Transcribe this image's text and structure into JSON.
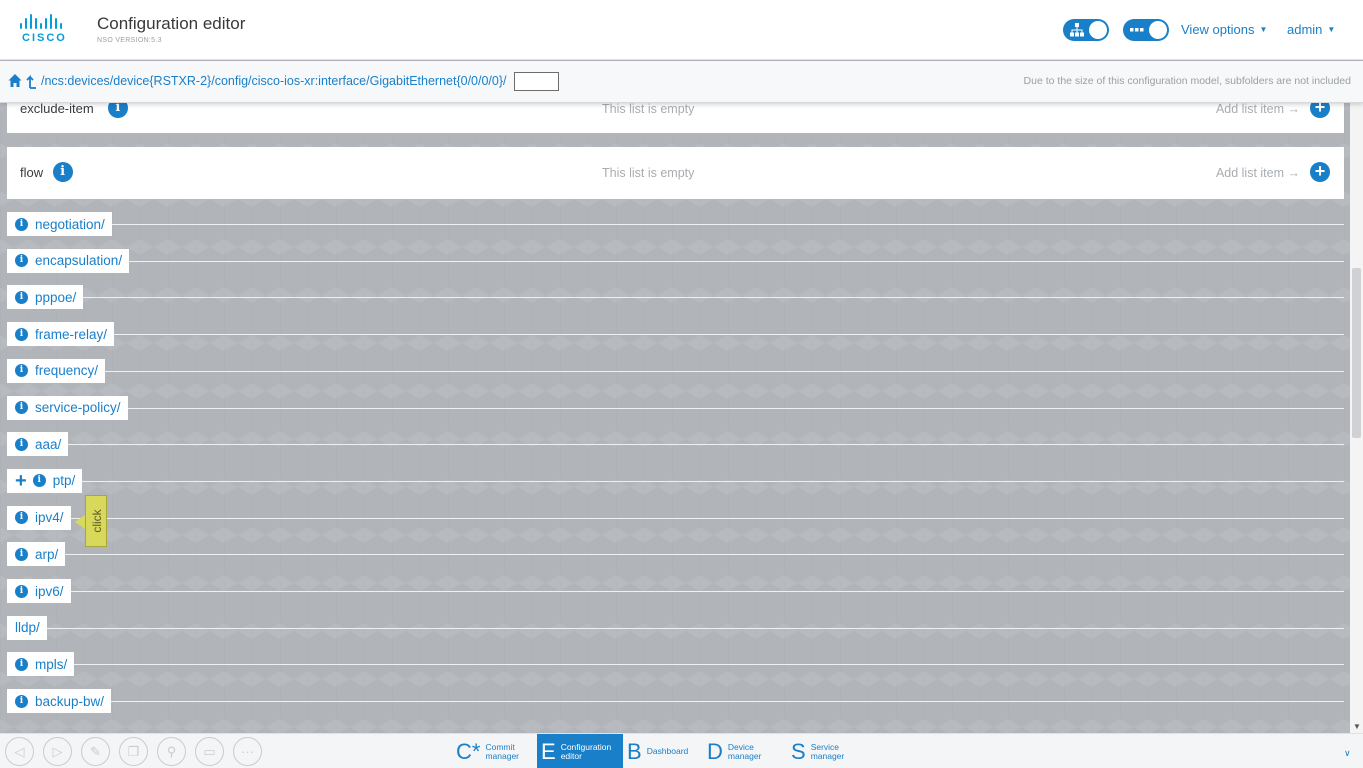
{
  "header": {
    "brand": "CISCO",
    "title": "Configuration editor",
    "version": "NSO VERSION:5.3",
    "view_options": "View options",
    "user": "admin",
    "toggle1_icon": "sitemap-icon",
    "toggle2_icon": "dots-icon"
  },
  "pathbar": {
    "path": "/ncs:devices/device{RSTXR-2}/config/cisco-ios-xr:interface/GigabitEthernet{0/0/0/0}/",
    "input_value": "",
    "note": "Due to the size of this configuration model, subfolders are not included"
  },
  "panels": [
    {
      "label": "exclude-item",
      "empty": "This list is empty",
      "add": "Add list item"
    },
    {
      "label": "flow",
      "empty": "This list is empty",
      "add": "Add list item"
    }
  ],
  "folders": [
    {
      "label": "negotiation/",
      "info": true,
      "expandable": false
    },
    {
      "label": "encapsulation/",
      "info": true,
      "expandable": false
    },
    {
      "label": "pppoe/",
      "info": true,
      "expandable": false
    },
    {
      "label": "frame-relay/",
      "info": true,
      "expandable": false
    },
    {
      "label": "frequency/",
      "info": true,
      "expandable": false
    },
    {
      "label": "service-policy/",
      "info": true,
      "expandable": false
    },
    {
      "label": "aaa/",
      "info": true,
      "expandable": false
    },
    {
      "label": "ptp/",
      "info": true,
      "expandable": true
    },
    {
      "label": "ipv4/",
      "info": true,
      "expandable": false
    },
    {
      "label": "arp/",
      "info": true,
      "expandable": false
    },
    {
      "label": "ipv6/",
      "info": true,
      "expandable": false
    },
    {
      "label": "lldp/",
      "info": false,
      "expandable": false
    },
    {
      "label": "mpls/",
      "info": true,
      "expandable": false
    },
    {
      "label": "backup-bw/",
      "info": true,
      "expandable": false
    }
  ],
  "tooltip": {
    "text": "click"
  },
  "bottom_nav": [
    {
      "letter": "C*",
      "label": "Commit manager",
      "active": false
    },
    {
      "letter": "E",
      "label": "Configuration editor",
      "active": true
    },
    {
      "letter": "B",
      "label": "Dashboard",
      "active": false
    },
    {
      "letter": "D",
      "label": "Device manager",
      "active": false
    },
    {
      "letter": "S",
      "label": "Service manager",
      "active": false
    }
  ],
  "toolbar_icons": [
    "back-icon",
    "forward-icon",
    "edit-icon",
    "copy-icon",
    "search-icon",
    "keyboard-icon",
    "more-icon"
  ]
}
